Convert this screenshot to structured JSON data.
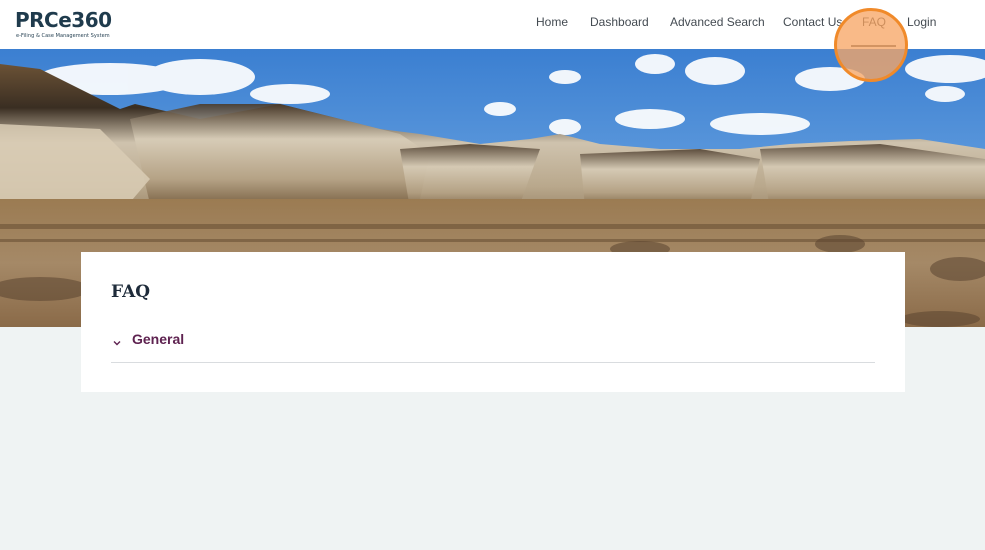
{
  "header": {
    "logo_text": "PRCe360",
    "logo_tagline": "e-Filing & Case Management System",
    "nav": [
      {
        "label": "Home"
      },
      {
        "label": "Dashboard"
      },
      {
        "label": "Advanced Search"
      },
      {
        "label": "Contact Us"
      },
      {
        "label": "FAQ",
        "active": true
      },
      {
        "label": "Login"
      }
    ]
  },
  "hero": {
    "image": "badlands-landscape"
  },
  "faq": {
    "title": "FAQ",
    "sections": [
      {
        "label": "General",
        "icon": "chevron-down-icon",
        "expanded": false
      }
    ]
  },
  "colors": {
    "accent": "#5e2250",
    "highlight": "#f08a2a",
    "background": "#eff3f3"
  }
}
